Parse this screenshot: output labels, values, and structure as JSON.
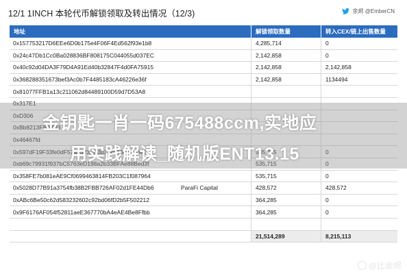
{
  "header": {
    "title": "12/1 1INCH 本轮代币解锁领取及转出情况（12/3)",
    "source": "余烬 @EmberCN"
  },
  "table": {
    "columns": [
      "地址",
      "解锁领取数量",
      "转入CEX/链上出售数量"
    ],
    "rows": [
      {
        "address": "0x157753217D6EEe6D0b175e4F06F4Ed562f93e1b8",
        "label": "",
        "claimed": "4,285,714",
        "sold": "0"
      },
      {
        "address": "0x24c47Db1Cc0Ba028836BF808175C044055d037EC",
        "label": "",
        "claimed": "2,142,858",
        "sold": "0"
      },
      {
        "address": "0x40c92d04DA3F79D4A91Ed40b32847F4d0FA75915",
        "label": "",
        "claimed": "2,142,858",
        "sold": "2,142,858"
      },
      {
        "address": "0x368288351673bef3Ac0b7F4485183cA46226e36f",
        "label": "",
        "claimed": "2,142,858",
        "sold": "1134494"
      },
      {
        "address": "0x81077FFB1a13c211062d84489100D59d7D53A8",
        "label": "",
        "claimed": "",
        "sold": ""
      },
      {
        "address": "0x317E1",
        "label": "",
        "claimed": "",
        "sold": ""
      },
      {
        "address": "0xD306",
        "label": "",
        "claimed": "",
        "sold": ""
      },
      {
        "address": "0xBb8213F8A0D3",
        "label": "",
        "claimed": "",
        "sold": ""
      },
      {
        "address": "0x46467fd",
        "label": "",
        "claimed": "",
        "sold": ""
      },
      {
        "address": "0x597dF19F33fe0dF57a5523FC3b396515085a0eC",
        "label": "",
        "claimed": "535,715",
        "sold": "0"
      },
      {
        "address": "0xb69c79931f937bC5763eD198a2b33BFAe88Bed3f",
        "label": "",
        "claimed": "535,715",
        "sold": "0"
      },
      {
        "address": "0x358FE7b081eAE9Cf0699463814FB203C1f087964",
        "label": "",
        "claimed": "535,715",
        "sold": "0"
      },
      {
        "address": "0x5028D77B91a3754fb38B2FBB726AF02d1FE44Db6",
        "label": "ParaFi Capital",
        "claimed": "428,572",
        "sold": "428,572"
      },
      {
        "address": "0xABc6Be50c62d583232602c92bd06fD2b5F502212",
        "label": "",
        "claimed": "364,285",
        "sold": "0"
      },
      {
        "address": "0x9F6176AF054f52811aeE367770bA4eAE4Be8Ffbb",
        "label": "",
        "claimed": "364,285",
        "sold": "0"
      },
      {
        "address": "",
        "label": "",
        "claimed": "",
        "sold": ""
      }
    ],
    "total": {
      "claimed": "21,514,289",
      "sold": "8,215,113"
    }
  },
  "watermark": {
    "line1": "金钥匙一肖一码675488ccm,实地应",
    "line2": "用实践解读_随机版ENT13.15",
    "corner": "@比余烬"
  },
  "colors": {
    "header_bg": "#2b6cbf",
    "twitter": "#1da1f2"
  },
  "icons": {
    "source": "twitter-bird-icon",
    "corner": "weibo-logo-icon"
  }
}
